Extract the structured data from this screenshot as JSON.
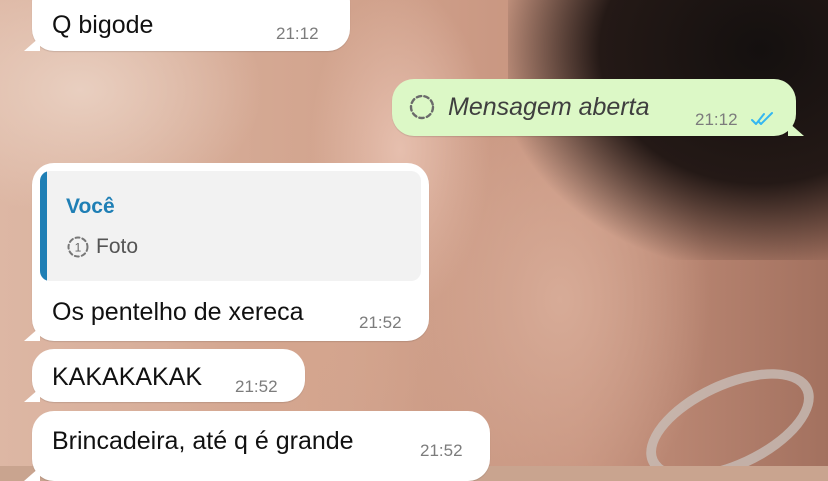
{
  "messages": {
    "m1": {
      "text": "Q bigode",
      "time": "21:12"
    },
    "m2": {
      "text": "Mensagem aberta",
      "time": "21:12",
      "status_icon": "double-check-read",
      "media_icon": "view-once-opened"
    },
    "m3": {
      "quote_author": "Você",
      "quote_text": "Foto",
      "quote_icon": "view-once-photo",
      "text": "Os pentelho de xereca",
      "time": "21:52"
    },
    "m4": {
      "text": "KAKAKAKAK",
      "time": "21:52"
    },
    "m5": {
      "text": "Brincadeira, até q é grande",
      "time": "21:52"
    }
  },
  "colors": {
    "incoming_bubble": "#ffffff",
    "outgoing_bubble": "#dcf8c6",
    "quote_accent": "#1f7fb5",
    "read_ticks": "#34b7f1"
  }
}
